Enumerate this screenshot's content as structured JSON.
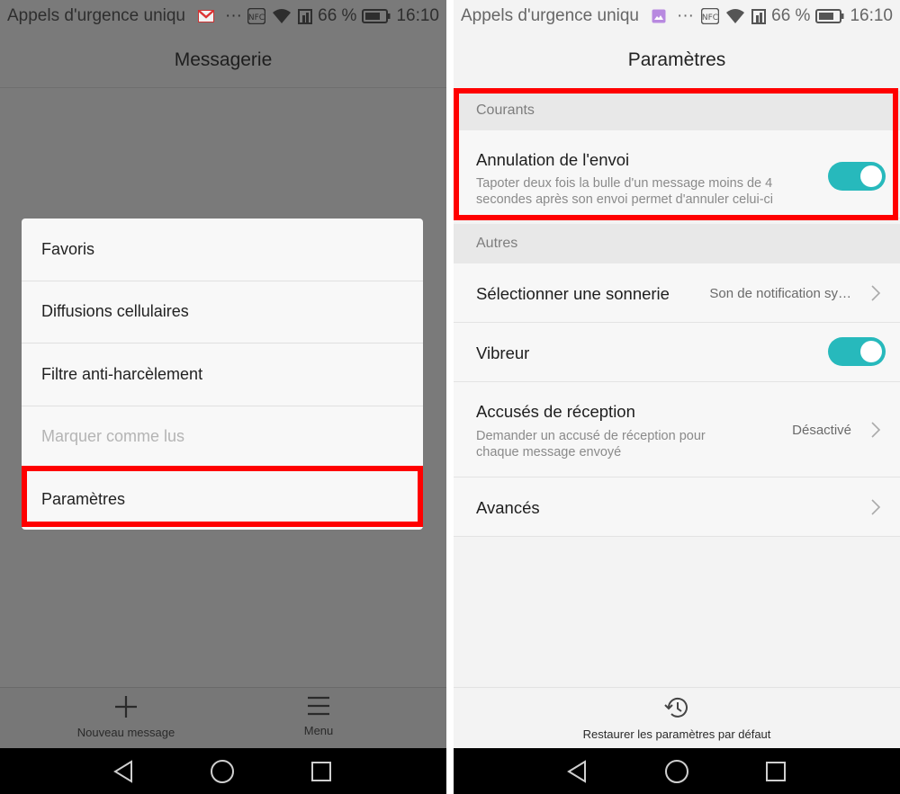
{
  "left": {
    "status": {
      "notification_text": "Appels d'urgence uniqu",
      "more": "···",
      "nfc": "NFC",
      "battery_pct": "66 %",
      "time": "16:10"
    },
    "title": "Messagerie",
    "menu_items": [
      {
        "label": "Favoris"
      },
      {
        "label": "Diffusions cellulaires"
      },
      {
        "label": "Filtre anti-harcèlement"
      },
      {
        "label": "Marquer comme lus"
      },
      {
        "label": "Paramètres"
      }
    ],
    "bottom": {
      "new_message": "Nouveau message",
      "menu": "Menu"
    }
  },
  "right": {
    "status": {
      "notification_text": "Appels d'urgence uniqu",
      "more": "···",
      "nfc": "NFC",
      "battery_pct": "66 %",
      "time": "16:10"
    },
    "title": "Paramètres",
    "sections": {
      "current": "Courants",
      "others": "Autres"
    },
    "settings": {
      "undo_send": {
        "title": "Annulation de l'envoi",
        "desc_line1": "Tapoter deux fois la bulle d'un message moins de 4",
        "desc_line2": "secondes après son envoi permet d'annuler celui-ci",
        "enabled": true
      },
      "ringtone": {
        "title": "Sélectionner une sonnerie",
        "value": "Son de notification sy…"
      },
      "vibrate": {
        "title": "Vibreur",
        "enabled": true
      },
      "receipts": {
        "title": "Accusés de réception",
        "desc_line1": "Demander un accusé de réception pour",
        "desc_line2": "chaque message envoyé",
        "value": "Désactivé"
      },
      "advanced": {
        "title": "Avancés"
      }
    },
    "bottom": {
      "restore": "Restaurer les paramètres par défaut"
    }
  },
  "colors": {
    "accent_toggle": "#27b9bc",
    "highlight": "#ff0000",
    "dim_background": "#7a7a7a"
  }
}
